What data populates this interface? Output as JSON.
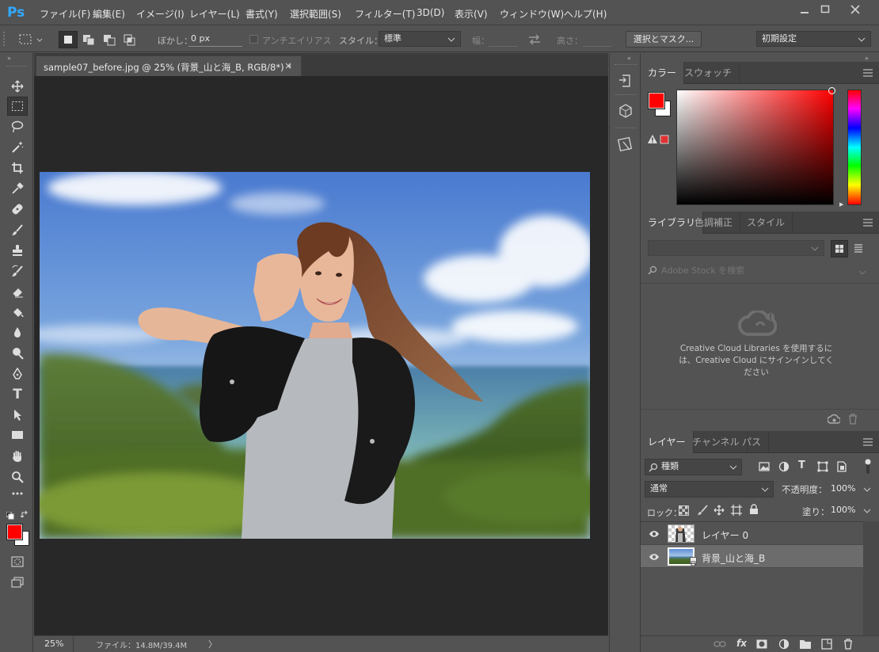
{
  "app": {
    "logo": "Ps",
    "menu": [
      "ファイル(F)",
      "編集(E)",
      "イメージ(I)",
      "レイヤー(L)",
      "書式(Y)",
      "選択範囲(S)",
      "フィルター(T)",
      "3D(D)",
      "表示(V)",
      "ウィンドウ(W)",
      "ヘルプ(H)"
    ],
    "window_controls": [
      "minimize-icon",
      "maximize-icon",
      "close-icon"
    ]
  },
  "options": {
    "feather_label": "ぼかし：",
    "feather_value": "0 px",
    "antialias_label": "アンチエイリアス",
    "style_label": "スタイル：",
    "style_value": "標準",
    "width_label": "幅：",
    "height_label": "高さ：",
    "select_mask_button": "選択とマスク...",
    "workspace_value": "初期設定"
  },
  "document": {
    "tab_title": "sample07_before.jpg @ 25% (背景_山と海_B, RGB/8*) *",
    "tab_close": "×",
    "zoom": "25%",
    "file_info": "ファイル：14.8M/39.4M",
    "status_arrow": "〉"
  },
  "color_panel": {
    "tabs": [
      "カラー",
      "スウォッチ"
    ],
    "foreground": "#ff0000",
    "background": "#ffffff"
  },
  "library_panel": {
    "tabs": [
      "ライブラリ",
      "色調補正",
      "スタイル"
    ],
    "search_placeholder": "Adobe Stock を検索",
    "message": "Creative Cloud Libraries を使用するには、Creative Cloud にサインインしてください"
  },
  "layers_panel": {
    "tabs": [
      "レイヤー",
      "チャンネル",
      "パス"
    ],
    "filter_kind": "種類",
    "blend_mode": "通常",
    "opacity_label": "不透明度：",
    "opacity_value": "100%",
    "lock_label": "ロック：",
    "fill_label": "塗り：",
    "fill_value": "100%",
    "layers": [
      {
        "name": "レイヤー 0",
        "selected": false
      },
      {
        "name": "背景_山と海_B",
        "selected": true
      }
    ]
  },
  "tools": [
    "move-tool",
    "marquee-tool",
    "lasso-tool",
    "magic-wand-tool",
    "crop-tool",
    "eyedropper-tool",
    "healing-tool",
    "brush-tool",
    "stamp-tool",
    "history-brush-tool",
    "eraser-tool",
    "paint-bucket-tool",
    "blur-tool",
    "dodge-tool",
    "pen-tool",
    "type-tool",
    "path-select-tool",
    "rectangle-tool",
    "hand-tool",
    "zoom-tool",
    "more-tools"
  ],
  "type_tool_glyph": "T"
}
